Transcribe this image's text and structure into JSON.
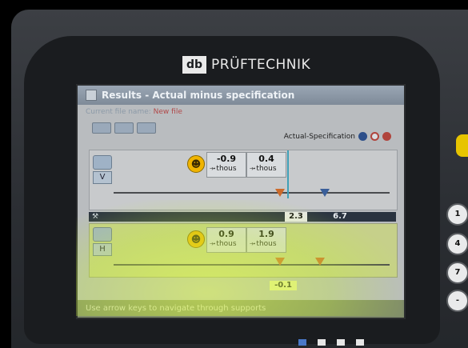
{
  "device": {
    "brand_logo_text": "db",
    "brand_name": "PRÜFTECHNIK"
  },
  "window": {
    "title": "Results - Actual minus specification",
    "file_label": "Current file name: ",
    "file_value": "New file"
  },
  "header": {
    "mode_label": "Actual-Specification"
  },
  "vertical_panel": {
    "plane_letter": "V",
    "value_1": "-0.9",
    "value_1_unit": "thous",
    "value_2": "0.4",
    "value_2_unit": "thous"
  },
  "distance_bar": {
    "value_1": "2.3",
    "value_2": "6.7"
  },
  "horizontal_panel": {
    "plane_letter": "H",
    "value_1": "0.9",
    "value_1_unit": "thous",
    "value_2": "1.9",
    "value_2_unit": "thous",
    "bottom_value": "-0.1"
  },
  "status_bar": {
    "text": "Use arrow keys to navigate through supports"
  },
  "keypad": {
    "keys": [
      "1",
      "4",
      "7",
      "-"
    ]
  },
  "colors": {
    "screen_bg": "#b9bcbf",
    "title_bar": "#7e8a98",
    "smiley": "#f0b400",
    "marker_orange": "#cc6a2a",
    "marker_blue": "#3a5f9a",
    "glare": "#e1ff46"
  }
}
